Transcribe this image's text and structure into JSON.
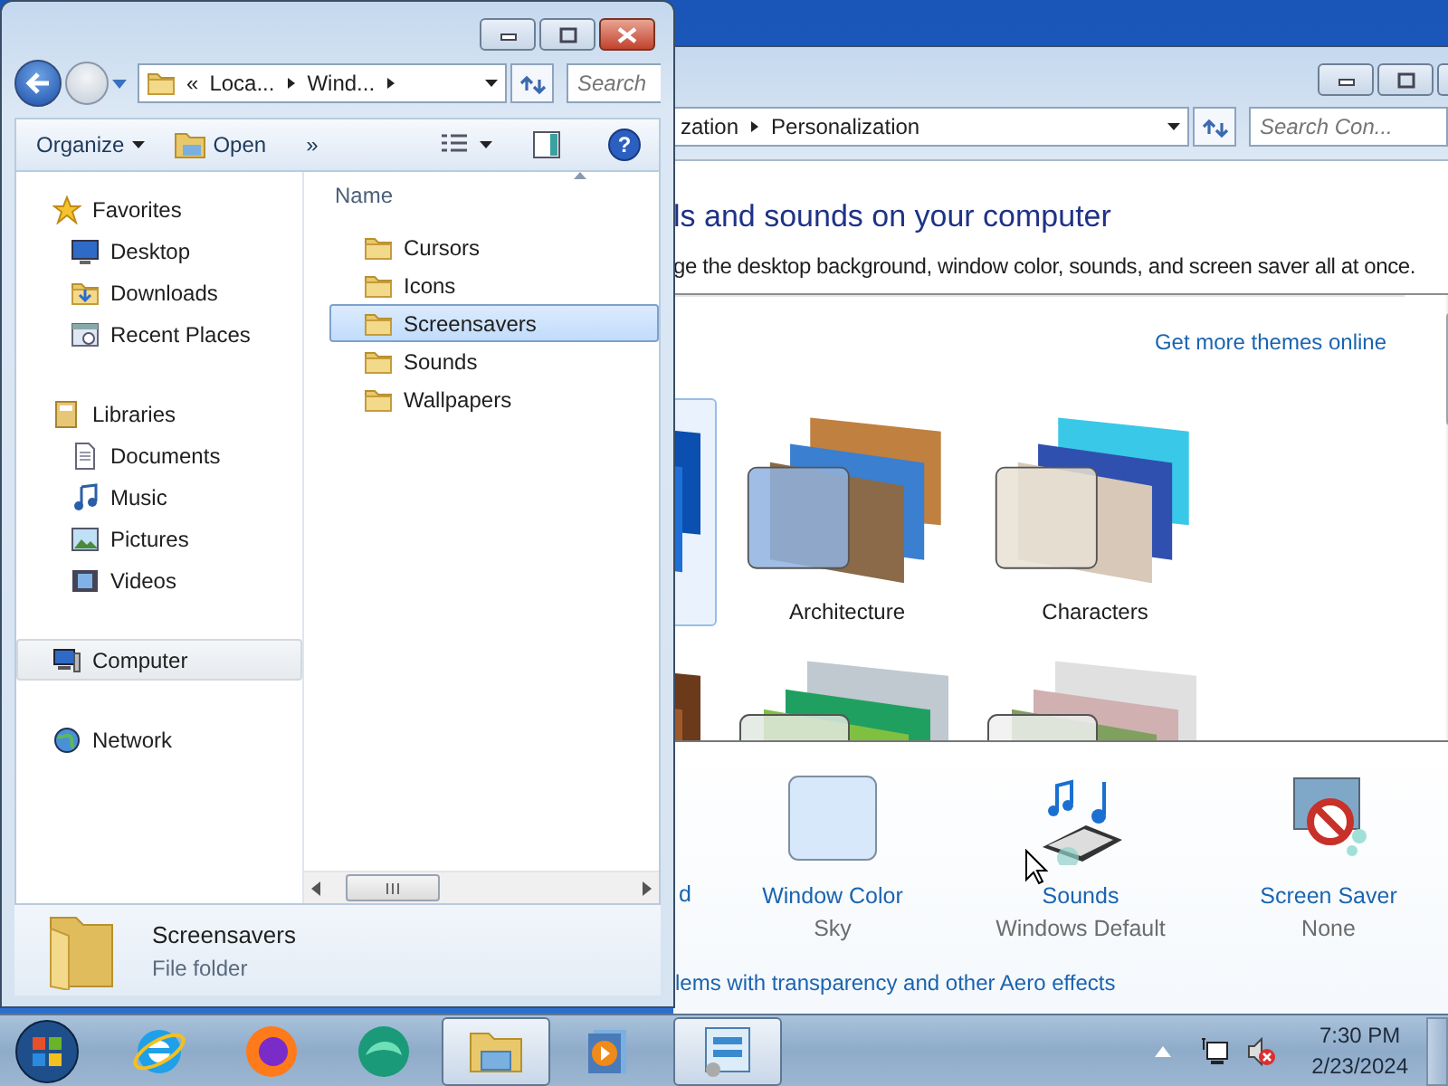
{
  "explorer": {
    "address": {
      "overflow": "«",
      "crumbs": [
        "Loca...",
        "Wind..."
      ]
    },
    "search": {
      "placeholder": "Search"
    },
    "toolbar": [
      {
        "label": "Organize",
        "kind": "menu"
      },
      {
        "label": "Open",
        "kind": "open"
      },
      {
        "label": "»",
        "kind": "more"
      }
    ],
    "nav": [
      {
        "label": "Favorites",
        "kind": "favorites",
        "selected": false,
        "children": [
          {
            "label": "Desktop",
            "kind": "desktop",
            "selected": false
          },
          {
            "label": "Downloads",
            "kind": "downloads",
            "selected": false
          },
          {
            "label": "Recent Places",
            "kind": "recent",
            "selected": false
          }
        ]
      },
      {
        "label": "Libraries",
        "kind": "libraries",
        "selected": false,
        "children": [
          {
            "label": "Documents",
            "kind": "documents",
            "selected": false
          },
          {
            "label": "Music",
            "kind": "music",
            "selected": false
          },
          {
            "label": "Pictures",
            "kind": "pictures",
            "selected": false
          },
          {
            "label": "Videos",
            "kind": "videos",
            "selected": false
          }
        ]
      },
      {
        "label": "Computer",
        "kind": "computer",
        "selected": true
      },
      {
        "label": "Network",
        "kind": "network",
        "selected": false
      }
    ],
    "help": "?",
    "column": "Name",
    "files": [
      {
        "name": "Cursors",
        "selected": false
      },
      {
        "name": "Icons",
        "selected": false
      },
      {
        "name": "Screensavers",
        "selected": true
      },
      {
        "name": "Sounds",
        "selected": false
      },
      {
        "name": "Wallpapers",
        "selected": false
      }
    ],
    "details": {
      "name": "Screensavers",
      "type": "File folder"
    }
  },
  "personalization": {
    "breadcrumb": [
      "zation",
      "Personalization"
    ],
    "search": {
      "placeholder": "Search Con..."
    },
    "heading": "ls and sounds on your computer",
    "subtitle": "ge the desktop background, window color, sounds, and screen saver all at once.",
    "themes_link": "Get more themes online",
    "themes": [
      {
        "kind": "blue",
        "selected": true
      },
      {
        "label": "Architecture",
        "kind": "architecture",
        "selected": false
      },
      {
        "label": "Characters",
        "kind": "characters",
        "selected": false
      },
      {
        "kind": "brown",
        "selected": false
      },
      {
        "kind": "landscapes",
        "selected": false
      },
      {
        "kind": "nature",
        "selected": false
      }
    ],
    "settings": [
      {
        "label": "d",
        "kind": "background"
      },
      {
        "label": "Window Color",
        "value": "Sky",
        "kind": "color"
      },
      {
        "label": "Sounds",
        "value": "Windows Default",
        "kind": "sounds"
      },
      {
        "label": "Screen Saver",
        "value": "None",
        "kind": "saver"
      }
    ],
    "aero_link": "lems with transparency and other Aero effects"
  },
  "taskbar": {
    "apps": [
      {
        "kind": "ie",
        "active": false
      },
      {
        "kind": "firefox",
        "active": false
      },
      {
        "kind": "edge",
        "active": false
      },
      {
        "kind": "explorer",
        "active": true
      },
      {
        "kind": "media",
        "active": false
      },
      {
        "kind": "control",
        "active": true
      }
    ],
    "time": "7:30 PM",
    "date": "2/23/2024"
  }
}
